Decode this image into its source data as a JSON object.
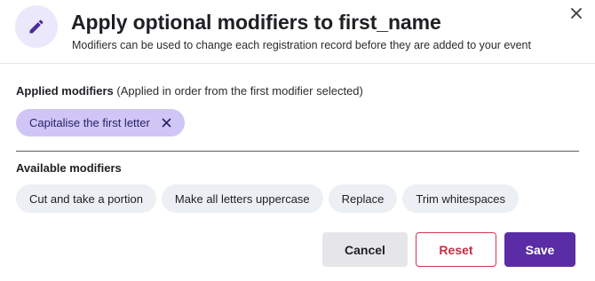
{
  "header": {
    "icon": "pencil-icon",
    "title": "Apply optional modifiers to first_name",
    "subtitle": "Modifiers can be used to change each registration record before they are added to your event",
    "close_icon": "close-icon"
  },
  "applied": {
    "label_bold": "Applied modifiers",
    "label_note": " (Applied in order from the first modifier selected)",
    "items": [
      {
        "label": "Capitalise the first letter",
        "remove_icon": "close-icon"
      }
    ]
  },
  "available": {
    "label": "Available modifiers",
    "items": [
      {
        "label": "Cut and take a portion"
      },
      {
        "label": "Make all letters uppercase"
      },
      {
        "label": "Replace"
      },
      {
        "label": "Trim whitespaces"
      }
    ]
  },
  "actions": {
    "cancel_label": "Cancel",
    "reset_label": "Reset",
    "save_label": "Save"
  },
  "colors": {
    "accent": "#5a2ca6",
    "applied_chip": "#cfc6f6",
    "available_chip": "#eceff3",
    "reset": "#c62f45",
    "icon_bg": "#ece8fb"
  }
}
